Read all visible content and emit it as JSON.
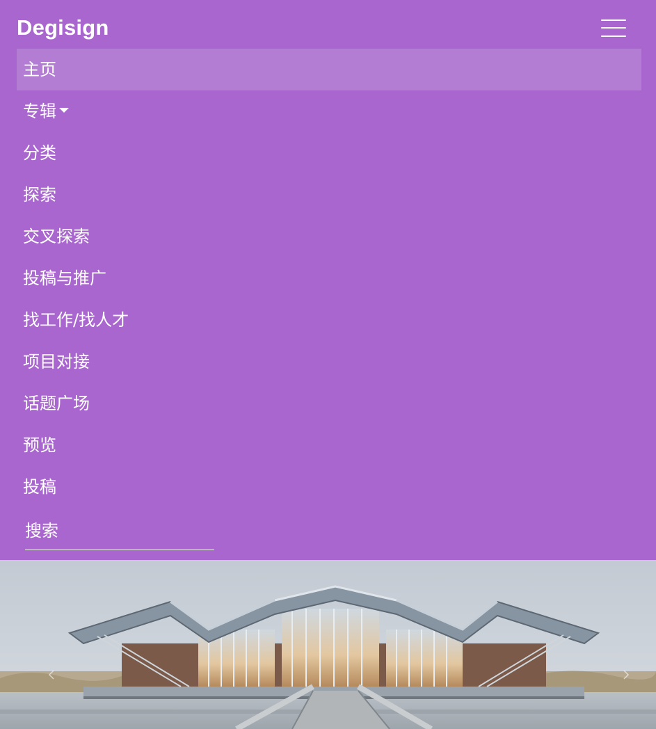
{
  "brand": {
    "name": "Degisign"
  },
  "nav": {
    "toggle_icon": "hamburger-menu-icon",
    "items": [
      {
        "label": "主页",
        "active": true
      },
      {
        "label": "专辑",
        "dropdown": true
      },
      {
        "label": "分类"
      },
      {
        "label": "探索"
      },
      {
        "label": "交叉探索"
      },
      {
        "label": "投稿与推广"
      },
      {
        "label": "找工作/找人才"
      },
      {
        "label": "项目对接"
      },
      {
        "label": "话题广场"
      },
      {
        "label": "预览"
      },
      {
        "label": "投稿"
      }
    ]
  },
  "search": {
    "placeholder": "搜索"
  },
  "carousel": {
    "prev_icon": "chevron-left-icon",
    "next_icon": "chevron-right-icon"
  },
  "colors": {
    "navbar_bg": "#a966cf",
    "active_item_bg": "#b37dd4",
    "text": "#ffffff"
  }
}
